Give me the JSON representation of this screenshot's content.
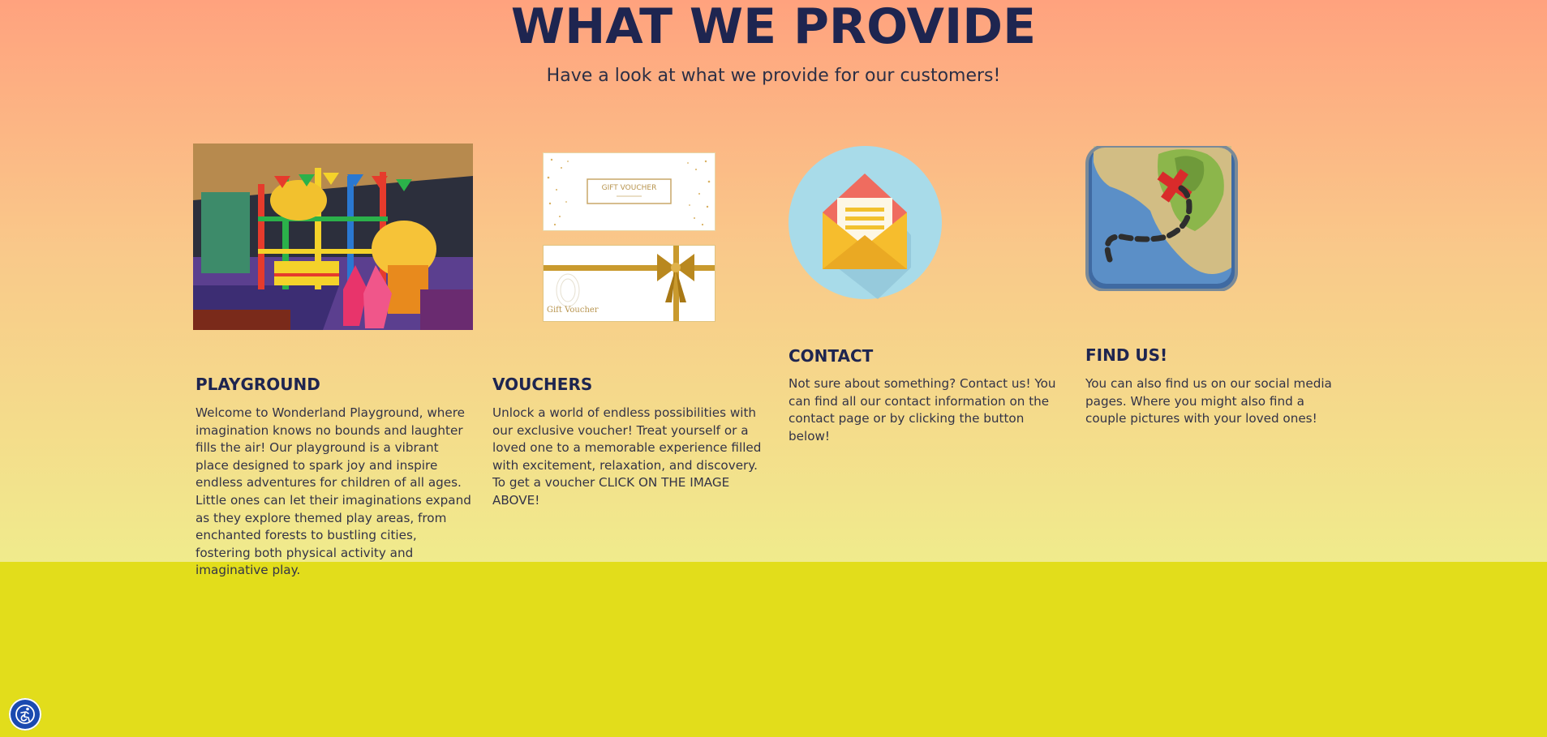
{
  "section": {
    "title": "WHAT WE PROVIDE",
    "subtitle": "Have a look at what we provide for our customers!"
  },
  "cards": [
    {
      "heading": "PLAYGROUND",
      "text": "Welcome to Wonderland Playground, where imagination knows no bounds and laughter fills the air! Our playground is a vibrant place designed to spark joy and inspire endless adventures for children of all ages. Little ones can let their imaginations expand as they explore themed play areas, from enchanted forests to bustling cities, fostering both physical activity and imaginative play."
    },
    {
      "heading": "VOUCHERS",
      "text": "Unlock a world of endless possibilities with our exclusive voucher! Treat yourself or a loved one to a memorable experience filled with excitement, relaxation, and discovery. To get a voucher CLICK ON THE IMAGE ABOVE!",
      "voucher_label_top": "GIFT VOUCHER",
      "voucher_label_bottom": "Gift Voucher"
    },
    {
      "heading": "CONTACT",
      "text": "Not sure about something? Contact us! You can find all our contact information on the contact page or by clicking the button below!"
    },
    {
      "heading": "FIND US!",
      "text": "You can also find us on our social media pages. Where you might also find a couple pictures with your loved ones!"
    }
  ],
  "icons": {
    "contact": "envelope-icon",
    "find_us": "treasure-map-icon",
    "accessibility": "accessibility-icon"
  },
  "colors": {
    "heading": "#1e2550",
    "footer_band": "#e2dd1b",
    "gradient_top": "#ffa27e",
    "gradient_bottom": "#f0eb8c",
    "accessibility_button": "#1a4ab0"
  }
}
